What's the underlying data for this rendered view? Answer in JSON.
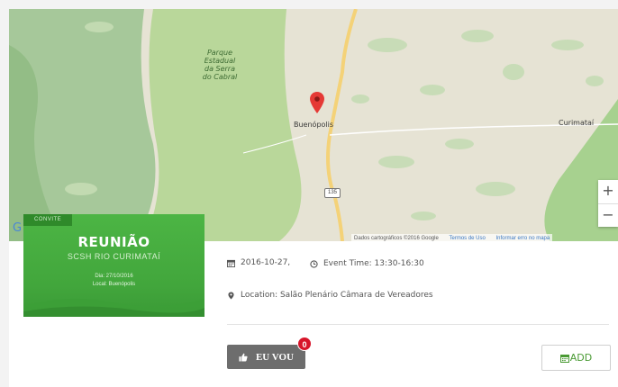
{
  "map": {
    "park_label": "Parque\nEstadual\nda Serra\ndo Cabral",
    "city_main": "Buenópolis",
    "city_east": "Curimataí",
    "road_number": "135",
    "zoom_in": "+",
    "zoom_out": "−",
    "google_mark": "G",
    "attribution": "Dados cartográficos ©2016 Google",
    "terms_link": "Termos de Uso",
    "report_link": "Informar erro no mapa",
    "colors": {
      "park": "#b9d79a",
      "land": "#e9e5d8",
      "road": "#f4d278",
      "pin": "#e53935"
    }
  },
  "flyer": {
    "tag": "CONVITE",
    "title": "REUNIÃO",
    "subtitle": "SCSH RIO CURIMATAÍ",
    "date_line": "Dia: 27/10/2016",
    "local_line": "Local: Buenópolis",
    "color": "#46ae40"
  },
  "event": {
    "date": "2016-10-27,",
    "time": "Event Time: 13:30-16:30",
    "location": "Location: Salão Plenário Câmara de Vereadores",
    "date_icon": "calendar-icon",
    "time_icon": "clock-icon",
    "location_icon": "map-marker-icon"
  },
  "actions": {
    "going_label": "EU VOU",
    "going_count": "0",
    "add_label": "ADD",
    "accent": "#4a9a34",
    "badge_color": "#d7152a"
  }
}
